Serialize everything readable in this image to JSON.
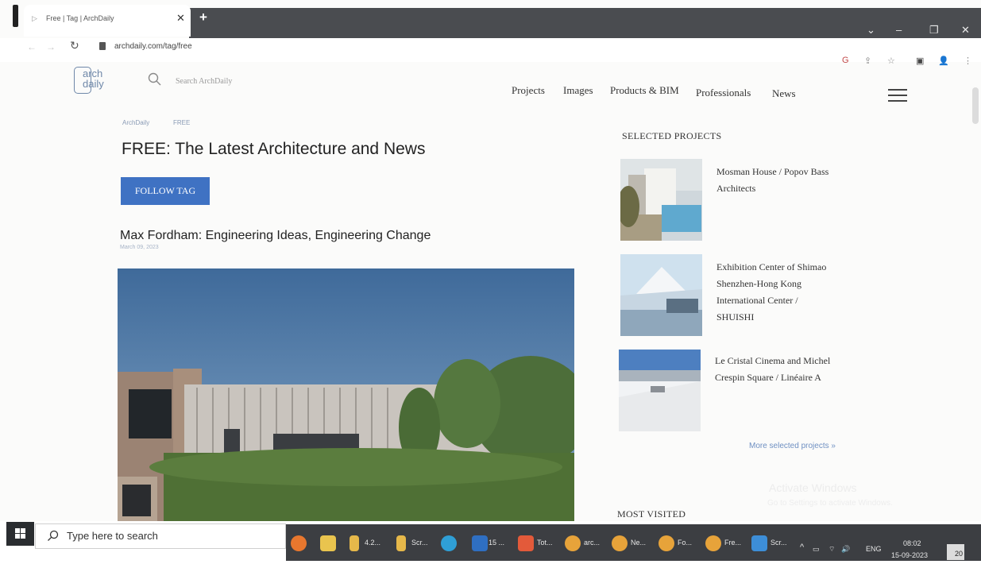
{
  "browser": {
    "tab_title": "Free | Tag | ArchDaily",
    "url": "archdaily.com/tag/free"
  },
  "site": {
    "logo_line1": "arch",
    "logo_line2": "daily",
    "search_placeholder": "Search ArchDaily",
    "nav": [
      "Projects",
      "Images",
      "Products & BIM",
      "Professionals",
      "News"
    ]
  },
  "main": {
    "breadcrumb": [
      "ArchDaily",
      "FREE"
    ],
    "title": "FREE: The Latest Architecture and News",
    "follow_label": "FOLLOW TAG",
    "article": {
      "title": "Max Fordham: Engineering Ideas, Engineering Change",
      "date": "March 09, 2023"
    }
  },
  "sidebar": {
    "selected_heading": "SELECTED PROJECTS",
    "projects": [
      {
        "lines": [
          "Mosman House / Popov Bass",
          "Architects"
        ]
      },
      {
        "lines": [
          "Exhibition Center of Shimao",
          "Shenzhen-Hong Kong",
          "International Center /",
          "SHUISHI"
        ]
      },
      {
        "lines": [
          "Le Cristal Cinema and Michel",
          "Crespin Square / Linéaire A"
        ]
      }
    ],
    "more_link": "More selected projects »",
    "most_visited_heading": "MOST VISITED"
  },
  "watermark": {
    "line1": "Activate Windows",
    "line2": "Go to Settings to activate Windows."
  },
  "taskbar": {
    "search_text": "Type here to search",
    "apps": [
      {
        "icon": "firefox-icon",
        "label": ""
      },
      {
        "icon": "notepad-icon",
        "label": ""
      },
      {
        "icon": "folder-icon",
        "label": "4.2..."
      },
      {
        "icon": "folder-icon",
        "label": "Scr..."
      },
      {
        "icon": "edge-icon",
        "label": ""
      },
      {
        "icon": "word-icon",
        "label": "15 ..."
      },
      {
        "icon": "quiz-icon",
        "label": "Tot..."
      },
      {
        "icon": "chrome-icon",
        "label": "arc..."
      },
      {
        "icon": "chrome-icon",
        "label": "Ne..."
      },
      {
        "icon": "chrome-icon",
        "label": "Fo..."
      },
      {
        "icon": "chrome-icon",
        "label": "Fre..."
      },
      {
        "icon": "screenshot-icon",
        "label": "Scr..."
      }
    ],
    "language": "ENG",
    "time": "08:02",
    "date": "15-09-2023",
    "notifications": "20"
  }
}
